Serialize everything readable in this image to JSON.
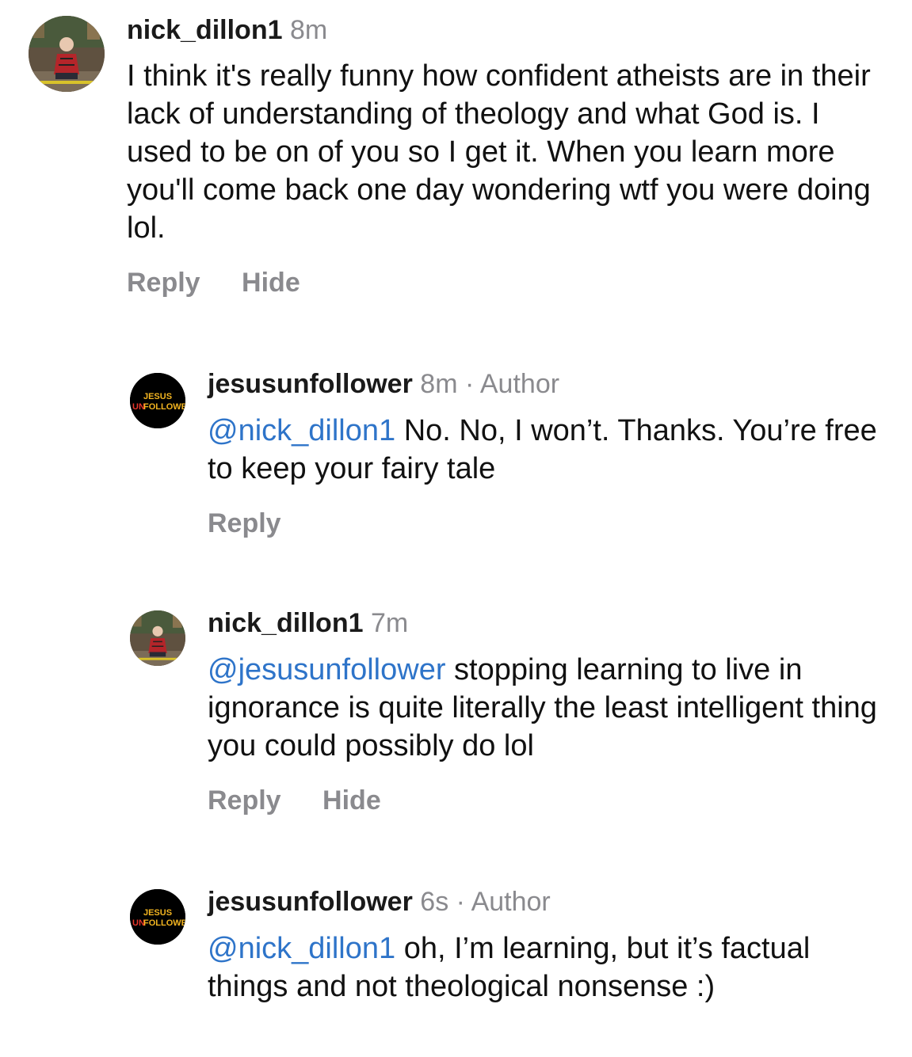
{
  "comments": [
    {
      "username": "nick_dillon1",
      "time": "8m",
      "author_tag": "",
      "mention": "",
      "text": "I think it's really funny how confident atheists are in their lack of understanding of theology and what God is. I used to be on of you so I get it. When you learn more you'll come back one day wondering wtf you were doing lol.",
      "actions": [
        "Reply",
        "Hide"
      ],
      "avatar": "user-photo-avatar"
    },
    {
      "username": "jesusunfollower",
      "time": "8m",
      "author_tag": "Author",
      "mention": "@nick_dillon1",
      "text": " No. No, I won’t. Thanks. You’re free to keep your fairy tale",
      "actions": [
        "Reply"
      ],
      "avatar": "jesus-unfollower-logo-avatar"
    },
    {
      "username": "nick_dillon1",
      "time": "7m",
      "author_tag": "",
      "mention": "@jesusunfollower",
      "text": " stopping learning to live in ignorance is quite literally the least intelligent thing you could possibly do lol",
      "actions": [
        "Reply",
        "Hide"
      ],
      "avatar": "user-photo-avatar"
    },
    {
      "username": "jesusunfollower",
      "time": "6s",
      "author_tag": "Author",
      "mention": "@nick_dillon1",
      "text": " oh, I’m learning, but it’s factual things and not theological nonsense :)",
      "actions": [],
      "avatar": "jesus-unfollower-logo-avatar"
    }
  ],
  "logo_text": [
    "JESUS",
    "UN",
    "FOLLOWER"
  ],
  "colors": {
    "mention": "#2e74c9",
    "muted": "#8a8a8e",
    "text": "#111111",
    "logo_accent": "#e8352a",
    "logo_yellow": "#f2b420"
  }
}
